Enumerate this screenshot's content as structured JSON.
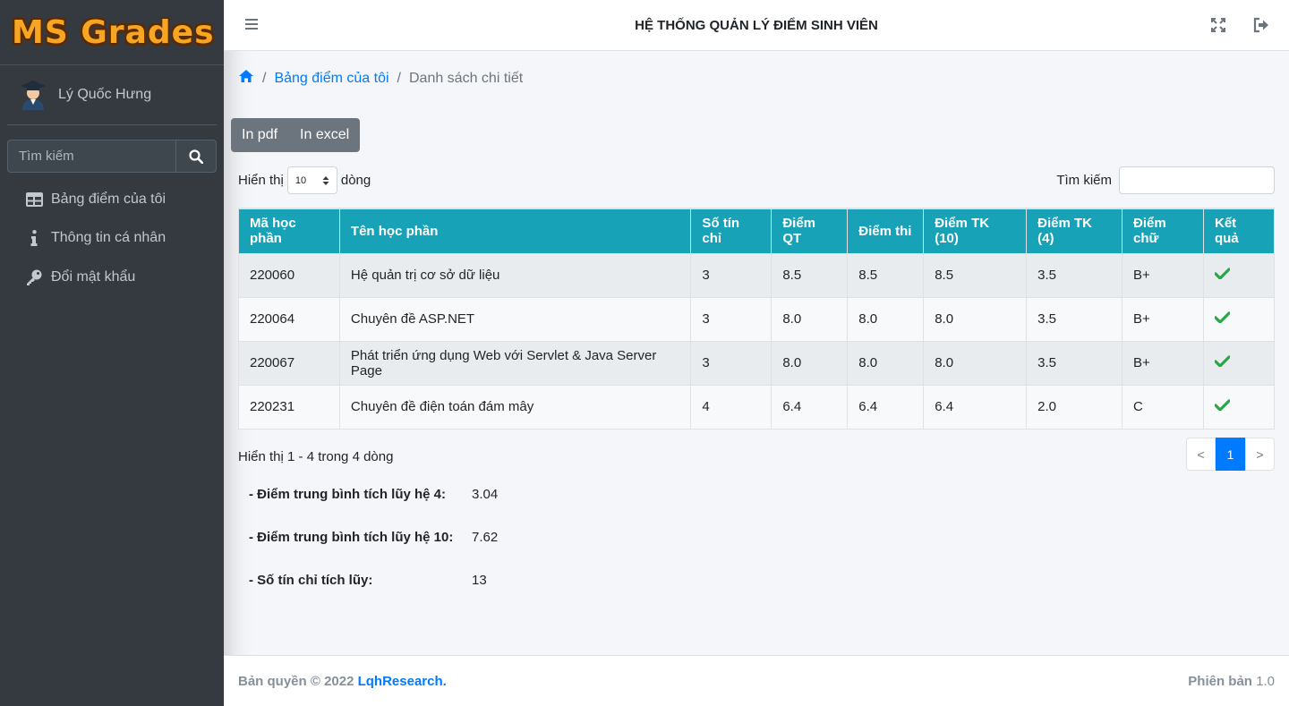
{
  "sidebar": {
    "brand": "MS Grades",
    "user_name": "Lý Quốc Hưng",
    "search_placeholder": "Tìm kiếm",
    "items": [
      {
        "label": "Bảng điểm của tôi",
        "icon": "table-icon"
      },
      {
        "label": "Thông tin cá nhân",
        "icon": "info-icon"
      },
      {
        "label": "Đổi mật khẩu",
        "icon": "key-icon"
      }
    ]
  },
  "header": {
    "title": "HỆ THỐNG QUẢN LÝ ĐIỂM SINH VIÊN"
  },
  "breadcrumb": {
    "home_icon": "home-icon",
    "link": "Bảng điểm của tôi",
    "active": "Danh sách chi tiết"
  },
  "toolbar": {
    "pdf_label": "In pdf",
    "excel_label": "In excel"
  },
  "table_controls": {
    "show_label": "Hiển thị",
    "page_size": "10",
    "rows_label": "dòng",
    "search_label": "Tìm kiếm"
  },
  "table": {
    "columns": [
      "Mã học phần",
      "Tên học phần",
      "Số tín chỉ",
      "Điểm QT",
      "Điểm thi",
      "Điểm TK (10)",
      "Điểm TK (4)",
      "Điểm chữ",
      "Kết quả"
    ],
    "rows": [
      {
        "code": "220060",
        "name": "Hệ quản trị cơ sở dữ liệu",
        "credits": "3",
        "qt": "8.5",
        "thi": "8.5",
        "tk10": "8.5",
        "tk4": "3.5",
        "letter": "B+",
        "result": "check-icon"
      },
      {
        "code": "220064",
        "name": "Chuyên đề ASP.NET",
        "credits": "3",
        "qt": "8.0",
        "thi": "8.0",
        "tk10": "8.0",
        "tk4": "3.5",
        "letter": "B+",
        "result": "check-icon"
      },
      {
        "code": "220067",
        "name": "Phát triển ứng dụng Web với Servlet & Java Server Page",
        "credits": "3",
        "qt": "8.0",
        "thi": "8.0",
        "tk10": "8.0",
        "tk4": "3.5",
        "letter": "B+",
        "result": "check-icon"
      },
      {
        "code": "220231",
        "name": "Chuyên đề điện toán đám mây",
        "credits": "4",
        "qt": "6.4",
        "thi": "6.4",
        "tk10": "6.4",
        "tk4": "2.0",
        "letter": "C",
        "result": "check-icon"
      }
    ]
  },
  "pagination": {
    "info": "Hiển thị 1 - 4 trong 4 dòng",
    "prev": "<",
    "current": "1",
    "next": ">"
  },
  "summary": {
    "gpa4_label": "- Điểm trung bình tích lũy hệ 4:",
    "gpa4_value": "3.04",
    "gpa10_label": "- Điểm trung bình tích lũy hệ 10:",
    "gpa10_value": "7.62",
    "credits_label": "- Số tín chỉ tích lũy:",
    "credits_value": "13"
  },
  "footer": {
    "copyright": "Bản quyền © 2022 ",
    "company": "LqhResearch.",
    "version_label": "Phiên bản",
    "version_value": "1.0"
  },
  "colors": {
    "sidebar_bg": "#343a40",
    "table_header": "#17a2b8",
    "accent": "#007bff",
    "success": "#28a745",
    "brand": "#f6a623"
  }
}
